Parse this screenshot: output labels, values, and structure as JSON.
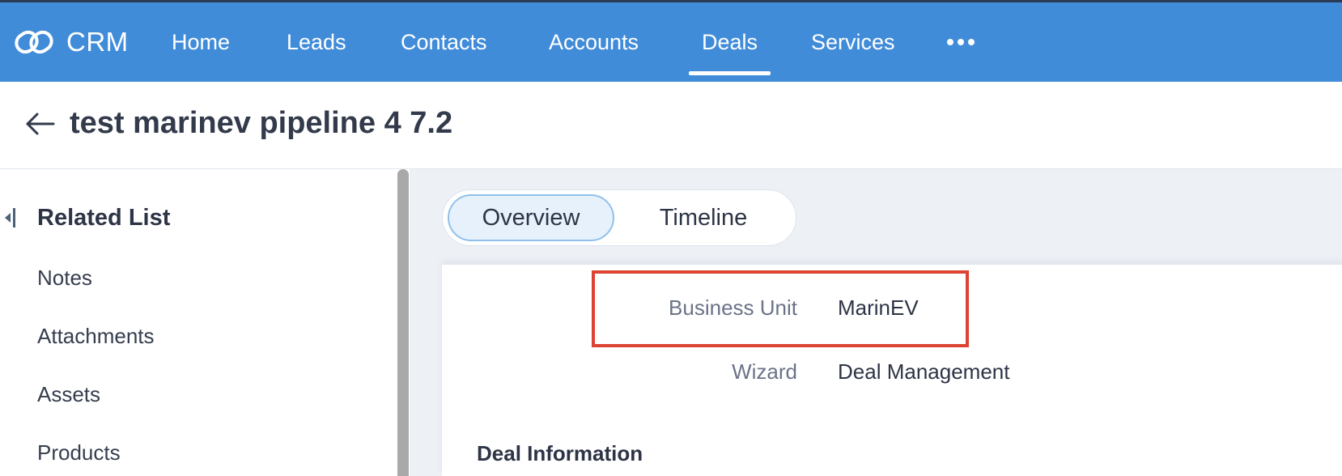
{
  "header": {
    "app_name": "CRM",
    "nav": [
      "Home",
      "Leads",
      "Contacts",
      "Accounts",
      "Deals",
      "Services"
    ],
    "active_tab": "Deals",
    "more_icon": "more-horizontal-icon",
    "brand_color": "#418cd9"
  },
  "record": {
    "title": "test marinev pipeline 4 7.2"
  },
  "sidebar": {
    "heading": "Related List",
    "items": [
      "Notes",
      "Attachments",
      "Assets",
      "Products"
    ]
  },
  "tabs": {
    "overview": "Overview",
    "timeline": "Timeline",
    "active": "Overview"
  },
  "fields": {
    "business_unit": {
      "label": "Business Unit",
      "value": "MarinEV"
    },
    "wizard": {
      "label": "Wizard",
      "value": "Deal Management"
    }
  },
  "section": {
    "title": "Deal Information"
  },
  "highlight_color": "#dc4332"
}
